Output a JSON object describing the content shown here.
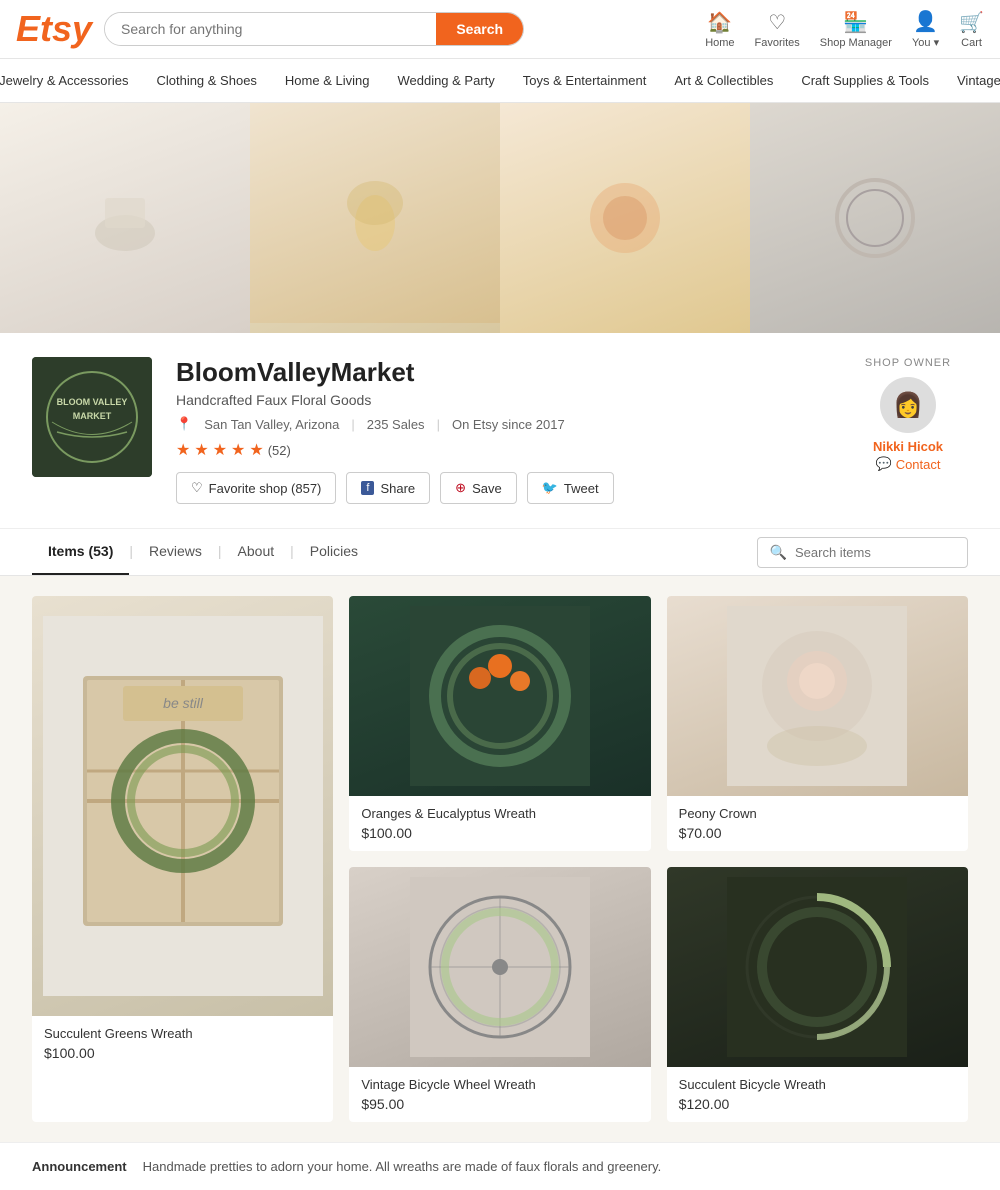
{
  "header": {
    "logo": "Etsy",
    "search_placeholder": "Search for anything",
    "search_button": "Search",
    "nav": [
      {
        "id": "home",
        "label": "Home",
        "icon": "🏠"
      },
      {
        "id": "favorites",
        "label": "Favorites",
        "icon": "♡"
      },
      {
        "id": "shop-manager",
        "label": "Shop Manager",
        "icon": "🏪"
      },
      {
        "id": "you",
        "label": "You ▾",
        "icon": "👤"
      },
      {
        "id": "cart",
        "label": "Cart",
        "icon": "🛒"
      }
    ]
  },
  "categories": [
    "Jewelry & Accessories",
    "Clothing & Shoes",
    "Home & Living",
    "Wedding & Party",
    "Toys & Entertainment",
    "Art & Collectibles",
    "Craft Supplies & Tools",
    "Vintage"
  ],
  "shop": {
    "name": "BloomValleyMarket",
    "subtitle": "Handcrafted Faux Floral Goods",
    "location": "San Tan Valley, Arizona",
    "sales": "235 Sales",
    "since": "On Etsy since 2017",
    "rating": 5,
    "review_count": "(52)",
    "actions": [
      {
        "id": "favorite",
        "label": "Favorite shop (857)",
        "icon": "♡"
      },
      {
        "id": "share",
        "label": "Share",
        "icon": "f"
      },
      {
        "id": "save",
        "label": "Save",
        "icon": "⊕"
      },
      {
        "id": "tweet",
        "label": "Tweet",
        "icon": "🐦"
      }
    ],
    "owner": {
      "label": "SHOP OWNER",
      "name": "Nikki Hicok",
      "contact": "Contact",
      "avatar_icon": "👩"
    }
  },
  "tabs": {
    "items": {
      "label": "Items (53)",
      "active": true
    },
    "reviews": "Reviews",
    "about": "About",
    "policies": "Policies",
    "search_placeholder": "Search items"
  },
  "items": [
    {
      "id": "item1",
      "title": "Succulent Greens Wreath",
      "price": "$100.00",
      "large": true,
      "bg": "linear-gradient(135deg, #d0d8c0 0%, #a8b898 100%)"
    },
    {
      "id": "item2",
      "title": "Oranges & Eucalyptus Wreath",
      "price": "$100.00",
      "large": false,
      "bg": "linear-gradient(135deg, #3a5c4a 0%, #2a4a3a 100%)"
    },
    {
      "id": "item3",
      "title": "Peony Crown",
      "price": "$70.00",
      "large": false,
      "bg": "linear-gradient(135deg, #e8ddd0 0%, #c8b8a0 100%)"
    },
    {
      "id": "item4",
      "title": "Vintage Bicycle Wheel Wreath",
      "price": "$95.00",
      "large": false,
      "bg": "linear-gradient(135deg, #d0c8c0 0%, #b0a8a0 100%)"
    },
    {
      "id": "item5",
      "title": "Succulent Bicycle Wreath",
      "price": "$120.00",
      "large": false,
      "bg": "linear-gradient(135deg, #304838 0%, #1a2820 100%)"
    }
  ],
  "announcement": {
    "label": "Announcement",
    "text": "Handmade pretties to adorn your home. All wreaths are made of faux florals and greenery."
  }
}
